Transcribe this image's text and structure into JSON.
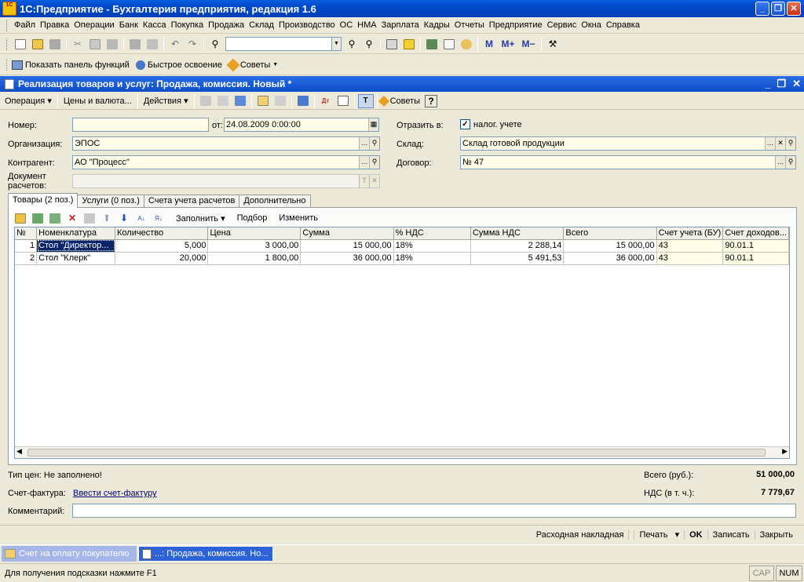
{
  "app": {
    "title": "1С:Предприятие - Бухгалтерия предприятия, редакция 1.6",
    "icon_text": "1С"
  },
  "menu": [
    "Файл",
    "Правка",
    "Операции",
    "Банк",
    "Касса",
    "Покупка",
    "Продажа",
    "Склад",
    "Производство",
    "ОС",
    "НМА",
    "Зарплата",
    "Кадры",
    "Отчеты",
    "Предприятие",
    "Сервис",
    "Окна",
    "Справка"
  ],
  "toolbar2": {
    "functions_label": "Показать панель функций",
    "quick_label": "Быстрое освоение",
    "tips_label": "Советы"
  },
  "document": {
    "title": "Реализация товаров и услуг: Продажа, комиссия. Новый *",
    "toolbar": {
      "operation": "Операция",
      "prices": "Цены и валюта...",
      "actions": "Действия",
      "tips": "Советы"
    },
    "fields": {
      "number_label": "Номер:",
      "number_value": "",
      "date_label": "от:",
      "date_value": "24.08.2009  0:00:00",
      "org_label": "Организация:",
      "org_value": "ЭПОС",
      "contractor_label": "Контрагент:",
      "contractor_value": "АО \"Процесс\"",
      "settlement_label_1": "Документ",
      "settlement_label_2": "расчетов:",
      "settlement_value": "",
      "reflect_label": "Отразить в:",
      "tax_check_label": "налог. учете",
      "warehouse_label": "Склад:",
      "warehouse_value": "Склад готовой продукции",
      "contract_label": "Договор:",
      "contract_value": "№ 47"
    },
    "tabs": [
      "Товары (2 поз.)",
      "Услуги (0 поз.)",
      "Счета учета расчетов",
      "Дополнительно"
    ],
    "table_toolbar": {
      "fill": "Заполнить",
      "select": "Подбор",
      "change": "Изменить"
    },
    "table": {
      "columns": [
        "№",
        "Номенклатура",
        "Количество",
        "Цена",
        "Сумма",
        "% НДС",
        "Сумма НДС",
        "Всего",
        "Счет учета (БУ)",
        "Счет доходов..."
      ],
      "rows": [
        [
          "1",
          "Стол \"Директор...",
          "5,000",
          "3 000,00",
          "15 000,00",
          "18%",
          "2 288,14",
          "15 000,00",
          "43",
          "90.01.1"
        ],
        [
          "2",
          "Стол \"Клерк\"",
          "20,000",
          "1 800,00",
          "36 000,00",
          "18%",
          "5 491,53",
          "36 000,00",
          "43",
          "90.01.1"
        ]
      ]
    },
    "footer": {
      "price_type": "Тип цен: Не заполнено!",
      "total_label": "Всего (руб.):",
      "total_value": "51 000,00",
      "invoice_label": "Счет-фактура:",
      "invoice_link": "Ввести счет-фактуру",
      "vat_label": "НДС (в т. ч.):",
      "vat_value": "7 779,67",
      "comment_label": "Комментарий:",
      "comment_value": ""
    },
    "buttons": [
      "Расходная накладная",
      "Печать",
      "OK",
      "Записать",
      "Закрыть"
    ]
  },
  "taskbar": [
    "Счет на оплату покупателю",
    "...: Продажа, комиссия. Но..."
  ],
  "status": {
    "hint": "Для получения подсказки нажмите F1",
    "cap": "CAP",
    "num": "NUM"
  }
}
